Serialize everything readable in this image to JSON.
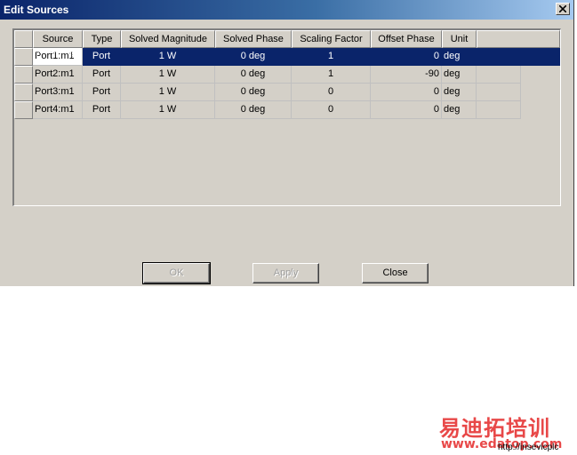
{
  "window": {
    "title": "Edit Sources"
  },
  "table": {
    "columns": [
      "Source",
      "Type",
      "Solved Magnitude",
      "Solved Phase",
      "Scaling Factor",
      "Offset Phase",
      "Unit"
    ],
    "rows": [
      {
        "source": "Port1:m1",
        "type": "Port",
        "solved_magnitude": "1 W",
        "solved_phase": "0 deg",
        "scaling_factor": "1",
        "offset_phase": "0",
        "unit": "deg"
      },
      {
        "source": "Port2:m1",
        "type": "Port",
        "solved_magnitude": "1 W",
        "solved_phase": "0 deg",
        "scaling_factor": "1",
        "offset_phase": "-90",
        "unit": "deg"
      },
      {
        "source": "Port3:m1",
        "type": "Port",
        "solved_magnitude": "1 W",
        "solved_phase": "0 deg",
        "scaling_factor": "0",
        "offset_phase": "0",
        "unit": "deg"
      },
      {
        "source": "Port4:m1",
        "type": "Port",
        "solved_magnitude": "1 W",
        "solved_phase": "0 deg",
        "scaling_factor": "0",
        "offset_phase": "0",
        "unit": "deg"
      }
    ],
    "selected_row": 0
  },
  "buttons": {
    "ok": "OK",
    "apply": "Apply",
    "close": "Close"
  },
  "watermark": {
    "brand": "易迪拓培训",
    "site": "www.edatop.com",
    "url_partial": "http://insevicplc"
  },
  "colors": {
    "selection": "#0a246a",
    "dialog_bg": "#d4d0c8",
    "watermark": "#e84848"
  }
}
